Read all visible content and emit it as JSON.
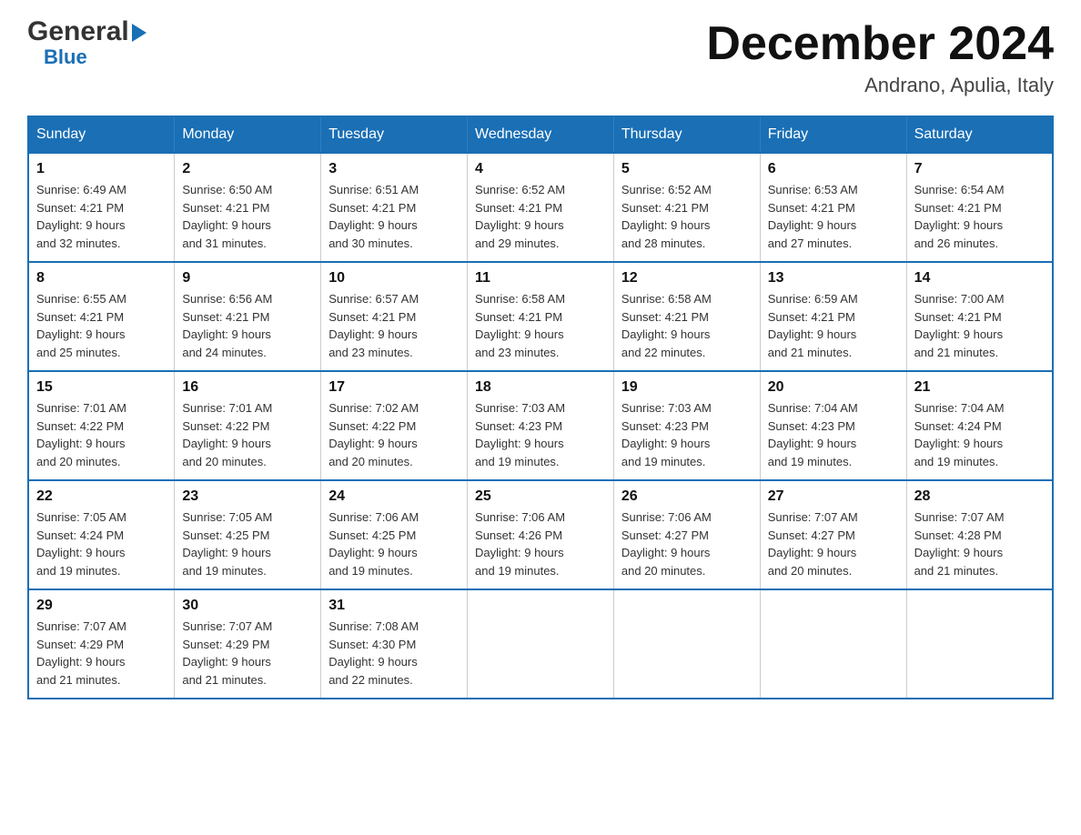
{
  "header": {
    "logo_general": "General",
    "logo_blue": "Blue",
    "month_title": "December 2024",
    "location": "Andrano, Apulia, Italy"
  },
  "weekdays": [
    "Sunday",
    "Monday",
    "Tuesday",
    "Wednesday",
    "Thursday",
    "Friday",
    "Saturday"
  ],
  "weeks": [
    [
      {
        "day": "1",
        "info": "Sunrise: 6:49 AM\nSunset: 4:21 PM\nDaylight: 9 hours\nand 32 minutes."
      },
      {
        "day": "2",
        "info": "Sunrise: 6:50 AM\nSunset: 4:21 PM\nDaylight: 9 hours\nand 31 minutes."
      },
      {
        "day": "3",
        "info": "Sunrise: 6:51 AM\nSunset: 4:21 PM\nDaylight: 9 hours\nand 30 minutes."
      },
      {
        "day": "4",
        "info": "Sunrise: 6:52 AM\nSunset: 4:21 PM\nDaylight: 9 hours\nand 29 minutes."
      },
      {
        "day": "5",
        "info": "Sunrise: 6:52 AM\nSunset: 4:21 PM\nDaylight: 9 hours\nand 28 minutes."
      },
      {
        "day": "6",
        "info": "Sunrise: 6:53 AM\nSunset: 4:21 PM\nDaylight: 9 hours\nand 27 minutes."
      },
      {
        "day": "7",
        "info": "Sunrise: 6:54 AM\nSunset: 4:21 PM\nDaylight: 9 hours\nand 26 minutes."
      }
    ],
    [
      {
        "day": "8",
        "info": "Sunrise: 6:55 AM\nSunset: 4:21 PM\nDaylight: 9 hours\nand 25 minutes."
      },
      {
        "day": "9",
        "info": "Sunrise: 6:56 AM\nSunset: 4:21 PM\nDaylight: 9 hours\nand 24 minutes."
      },
      {
        "day": "10",
        "info": "Sunrise: 6:57 AM\nSunset: 4:21 PM\nDaylight: 9 hours\nand 23 minutes."
      },
      {
        "day": "11",
        "info": "Sunrise: 6:58 AM\nSunset: 4:21 PM\nDaylight: 9 hours\nand 23 minutes."
      },
      {
        "day": "12",
        "info": "Sunrise: 6:58 AM\nSunset: 4:21 PM\nDaylight: 9 hours\nand 22 minutes."
      },
      {
        "day": "13",
        "info": "Sunrise: 6:59 AM\nSunset: 4:21 PM\nDaylight: 9 hours\nand 21 minutes."
      },
      {
        "day": "14",
        "info": "Sunrise: 7:00 AM\nSunset: 4:21 PM\nDaylight: 9 hours\nand 21 minutes."
      }
    ],
    [
      {
        "day": "15",
        "info": "Sunrise: 7:01 AM\nSunset: 4:22 PM\nDaylight: 9 hours\nand 20 minutes."
      },
      {
        "day": "16",
        "info": "Sunrise: 7:01 AM\nSunset: 4:22 PM\nDaylight: 9 hours\nand 20 minutes."
      },
      {
        "day": "17",
        "info": "Sunrise: 7:02 AM\nSunset: 4:22 PM\nDaylight: 9 hours\nand 20 minutes."
      },
      {
        "day": "18",
        "info": "Sunrise: 7:03 AM\nSunset: 4:23 PM\nDaylight: 9 hours\nand 19 minutes."
      },
      {
        "day": "19",
        "info": "Sunrise: 7:03 AM\nSunset: 4:23 PM\nDaylight: 9 hours\nand 19 minutes."
      },
      {
        "day": "20",
        "info": "Sunrise: 7:04 AM\nSunset: 4:23 PM\nDaylight: 9 hours\nand 19 minutes."
      },
      {
        "day": "21",
        "info": "Sunrise: 7:04 AM\nSunset: 4:24 PM\nDaylight: 9 hours\nand 19 minutes."
      }
    ],
    [
      {
        "day": "22",
        "info": "Sunrise: 7:05 AM\nSunset: 4:24 PM\nDaylight: 9 hours\nand 19 minutes."
      },
      {
        "day": "23",
        "info": "Sunrise: 7:05 AM\nSunset: 4:25 PM\nDaylight: 9 hours\nand 19 minutes."
      },
      {
        "day": "24",
        "info": "Sunrise: 7:06 AM\nSunset: 4:25 PM\nDaylight: 9 hours\nand 19 minutes."
      },
      {
        "day": "25",
        "info": "Sunrise: 7:06 AM\nSunset: 4:26 PM\nDaylight: 9 hours\nand 19 minutes."
      },
      {
        "day": "26",
        "info": "Sunrise: 7:06 AM\nSunset: 4:27 PM\nDaylight: 9 hours\nand 20 minutes."
      },
      {
        "day": "27",
        "info": "Sunrise: 7:07 AM\nSunset: 4:27 PM\nDaylight: 9 hours\nand 20 minutes."
      },
      {
        "day": "28",
        "info": "Sunrise: 7:07 AM\nSunset: 4:28 PM\nDaylight: 9 hours\nand 21 minutes."
      }
    ],
    [
      {
        "day": "29",
        "info": "Sunrise: 7:07 AM\nSunset: 4:29 PM\nDaylight: 9 hours\nand 21 minutes."
      },
      {
        "day": "30",
        "info": "Sunrise: 7:07 AM\nSunset: 4:29 PM\nDaylight: 9 hours\nand 21 minutes."
      },
      {
        "day": "31",
        "info": "Sunrise: 7:08 AM\nSunset: 4:30 PM\nDaylight: 9 hours\nand 22 minutes."
      },
      null,
      null,
      null,
      null
    ]
  ]
}
